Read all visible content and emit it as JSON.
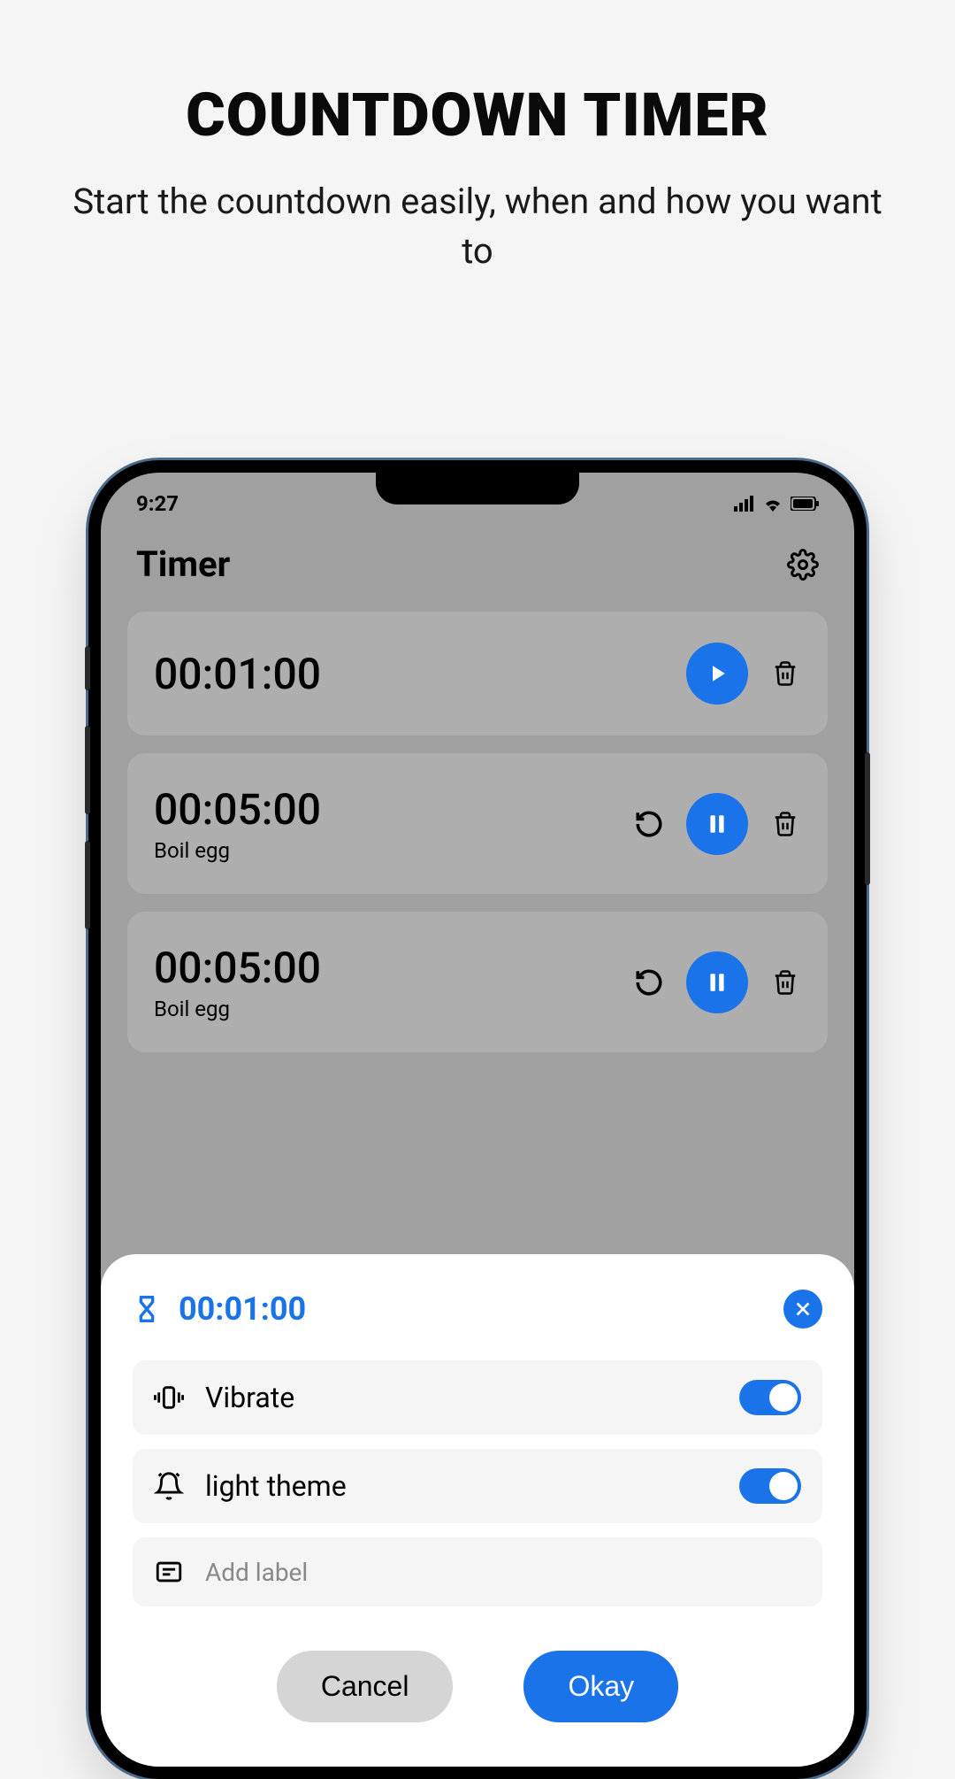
{
  "page": {
    "title": "COUNTDOWN TIMER",
    "subtitle": "Start the countdown easily, when and how you want to"
  },
  "status": {
    "time": "9:27"
  },
  "app": {
    "title": "Timer"
  },
  "timers": [
    {
      "time": "00:01:00",
      "label": "",
      "state": "play",
      "showReset": false
    },
    {
      "time": "00:05:00",
      "label": "Boil egg",
      "state": "pause",
      "showReset": true
    },
    {
      "time": "00:05:00",
      "label": "Boil egg",
      "state": "pause",
      "showReset": true
    }
  ],
  "sheet": {
    "time": "00:01:00",
    "settings": {
      "vibrate_label": "Vibrate",
      "theme_label": "light theme",
      "addlabel_placeholder": "Add label"
    },
    "buttons": {
      "cancel": "Cancel",
      "okay": "Okay"
    }
  },
  "colors": {
    "accent": "#1a73e8"
  }
}
